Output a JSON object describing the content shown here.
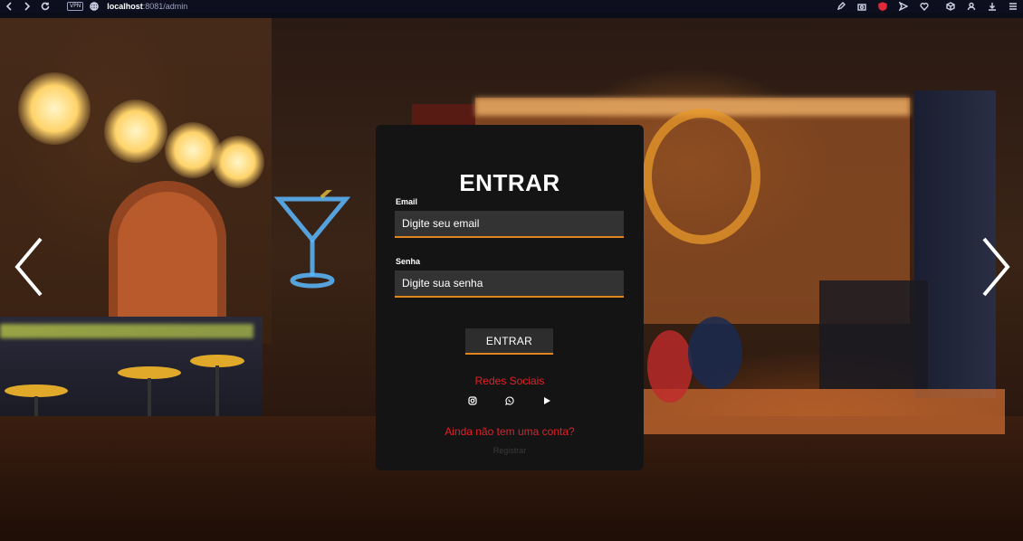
{
  "browser": {
    "vpn_label": "VPN",
    "url_host": "localhost",
    "url_path": ":8081/admin"
  },
  "login": {
    "title": "ENTRAR",
    "email_label": "Email",
    "email_placeholder": "Digite seu email",
    "password_label": "Senha",
    "password_placeholder": "Digite sua senha",
    "submit_label": "ENTRAR",
    "social_title": "Redes Sociais",
    "social_icons": [
      "instagram-icon",
      "whatsapp-icon",
      "youtube-icon"
    ],
    "signup_question": "Ainda não tem uma conta?",
    "register_label": "Registrar"
  },
  "colors": {
    "card_bg": "#141414",
    "input_bg": "#333333",
    "accent_orange": "#e0861e",
    "accent_red": "#e0202a"
  }
}
